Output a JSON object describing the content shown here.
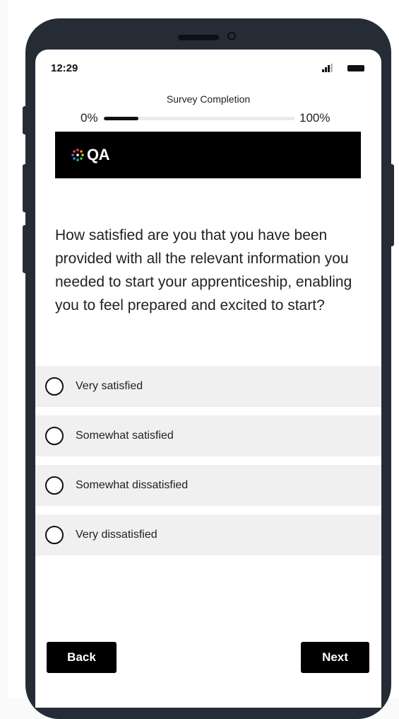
{
  "status_bar": {
    "time": "12:29"
  },
  "progress": {
    "title": "Survey Completion",
    "start_label": "0%",
    "end_label": "100%",
    "value_percent": 18
  },
  "banner": {
    "logo_text": "QA",
    "background": "#000000"
  },
  "question": {
    "text": "How satisfied are you that you have been provided with all the relevant information you needed to start your apprenticeship, enabling you to feel prepared and excited to start?"
  },
  "options": [
    {
      "label": "Very satisfied"
    },
    {
      "label": "Somewhat satisfied"
    },
    {
      "label": "Somewhat dissatisfied"
    },
    {
      "label": "Very dissatisfied"
    }
  ],
  "nav": {
    "back_label": "Back",
    "next_label": "Next"
  },
  "colors": {
    "phone_frame": "#252c36",
    "option_background": "#f0f0f0",
    "button_background": "#000000"
  }
}
